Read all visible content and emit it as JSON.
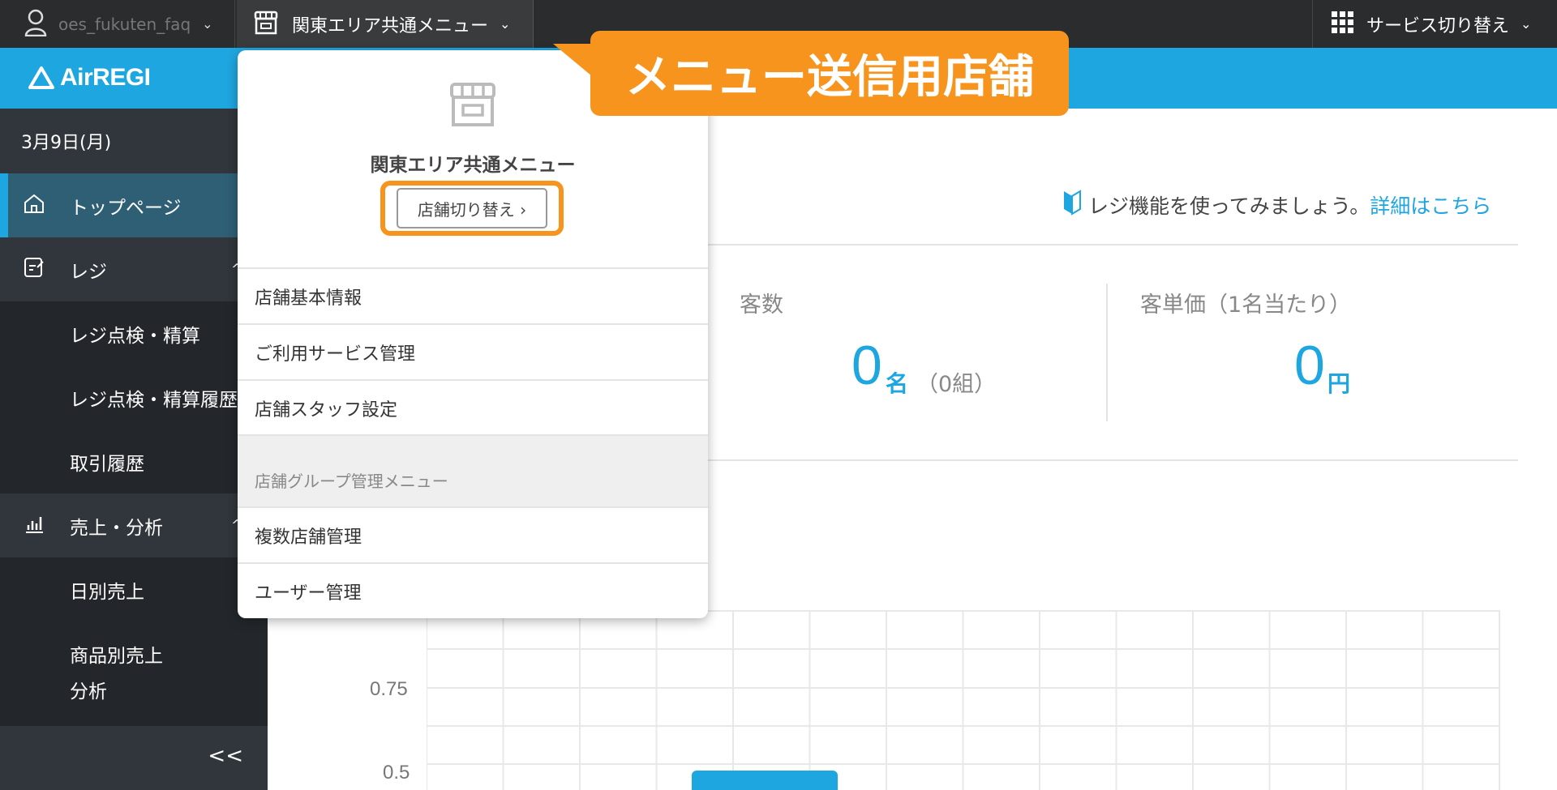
{
  "topbar": {
    "user_name": "oes_fukuten_faq",
    "store_name": "関東エリア共通メニュー",
    "service_switch": "サービス切り替え"
  },
  "header": {
    "logo_text": "AirREGI"
  },
  "sidebar": {
    "date": "3月9日(月)",
    "items": [
      {
        "label": "トップページ"
      },
      {
        "label": "レジ"
      },
      {
        "label": "レジ点検・精算"
      },
      {
        "label": "レジ点検・精算履歴"
      },
      {
        "label": "取引履歴"
      },
      {
        "label": "売上・分析"
      },
      {
        "label": "日別売上"
      },
      {
        "label": "商品別売上"
      },
      {
        "label": "分析"
      }
    ],
    "collapse": "<<"
  },
  "main": {
    "intro_text": "レジ機能を使ってみましょう。",
    "intro_link": "詳細はこちら",
    "customers": {
      "label": "客数",
      "value": "0",
      "unit": "名",
      "extra": "（0組）"
    },
    "avg_price": {
      "label": "客単価（1名当たり）",
      "value": "0",
      "unit": "円"
    },
    "chart_ticks": [
      "0.75",
      "0.5"
    ]
  },
  "dropdown": {
    "store_title": "関東エリア共通メニュー",
    "switch_button": "店舗切り替え ›",
    "items": [
      "店舗基本情報",
      "ご利用サービス管理",
      "店舗スタッフ設定"
    ],
    "group_label": "店舗グループ管理メニュー",
    "group_items": [
      "複数店舗管理",
      "ユーザー管理"
    ]
  },
  "callout": {
    "text": "メニュー送信用店舗"
  },
  "colors": {
    "accent": "#1ea6e0",
    "callout": "#f7941d",
    "sidebar_bg": "#23272b",
    "topbar_bg": "#2b2c2e"
  }
}
